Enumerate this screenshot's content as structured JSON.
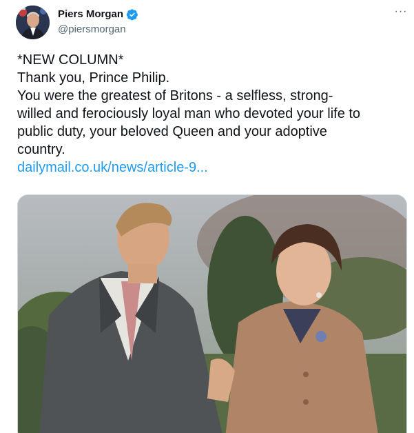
{
  "author": {
    "name": "Piers Morgan",
    "handle": "@piersmorgan",
    "verified": true,
    "avatar_icon": "avatar-photo",
    "verified_icon": "verified-badge-icon"
  },
  "menu": {
    "more_label": "···",
    "icon": "more-horizontal-icon"
  },
  "tweet": {
    "lines": [
      "*NEW COLUMN*",
      "Thank you, Prince Philip.",
      "You were the greatest of Britons - a selfless, strong-",
      "willed and ferociously loyal man who devoted your life to",
      "public duty, your beloved Queen and your adoptive",
      "country."
    ],
    "link_text": "dailymail.co.uk/news/article-9..."
  },
  "colors": {
    "text": "#0f1419",
    "secondary": "#536471",
    "link": "#1d9bf0",
    "verified": "#1d9bf0",
    "border": "#cfd9de"
  },
  "media": {
    "type": "photo",
    "description_icon": "photo-couple-walking"
  }
}
